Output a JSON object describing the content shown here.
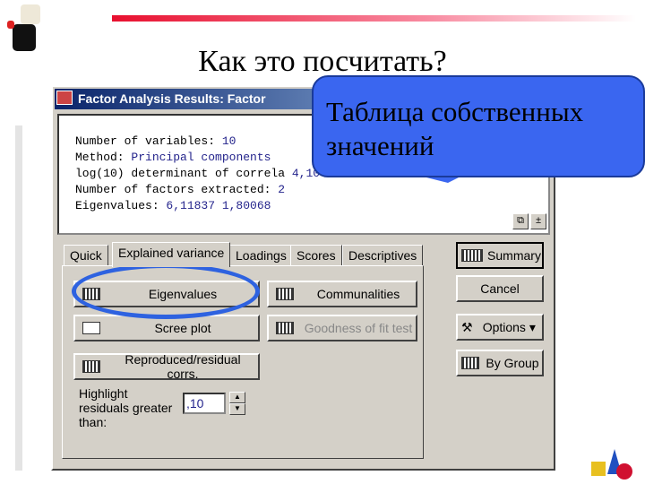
{
  "slide": {
    "title": "Как это посчитать?",
    "callout": "Таблица собственных значений"
  },
  "window": {
    "title": "Factor Analysis Results: Factor",
    "output": [
      {
        "label": "Number of variables: ",
        "value": "10"
      },
      {
        "label": "Method: ",
        "value": "Principal components"
      },
      {
        "label": "log(10) determinant of correla",
        "value": "4,10"
      },
      {
        "label": "Number of factors extracted: ",
        "value": "2"
      },
      {
        "label": "Eigenvalues: ",
        "value": "6,11837  1,80068"
      }
    ],
    "tabs": [
      "Quick",
      "Explained variance",
      "Loadings",
      "Scores",
      "Descriptives"
    ],
    "active_tab": "Explained variance",
    "buttons": {
      "eigenvalues": "Eigenvalues",
      "communalities": "Communalities",
      "scree": "Scree plot",
      "goodness": "Goodness of fit test",
      "reproduced": "Reproduced/residual corrs."
    },
    "highlight_label": "Highlight residuals greater than:",
    "highlight_value": ",10",
    "side": {
      "summary": "Summary",
      "cancel": "Cancel",
      "options": "Options ▾",
      "bygroup": "By Group"
    }
  },
  "colors": {
    "callout": "#3a66f0",
    "accent_line": "#e8102f",
    "highlight_ellipse": "#2e62e0"
  }
}
